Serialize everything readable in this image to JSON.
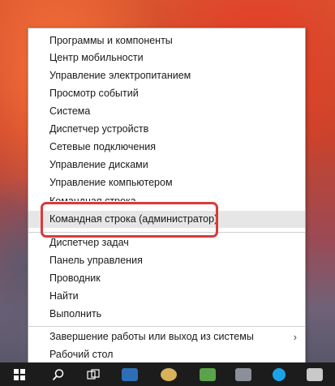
{
  "menu": {
    "items": [
      {
        "label": "Программы и компоненты"
      },
      {
        "label": "Центр мобильности"
      },
      {
        "label": "Управление электропитанием"
      },
      {
        "label": "Просмотр событий"
      },
      {
        "label": "Система"
      },
      {
        "label": "Диспетчер устройств"
      },
      {
        "label": "Сетевые подключения"
      },
      {
        "label": "Управление дисками"
      },
      {
        "label": "Управление компьютером"
      },
      {
        "label": "Командная строка"
      },
      {
        "label": "Командная строка (администратор)"
      },
      {
        "label": "Диспетчер задач"
      },
      {
        "label": "Панель управления"
      },
      {
        "label": "Проводник"
      },
      {
        "label": "Найти"
      },
      {
        "label": "Выполнить"
      },
      {
        "label": "Завершение работы или выход из системы"
      },
      {
        "label": "Рабочий стол"
      }
    ],
    "submenu_arrow": "›",
    "highlighted_item": "Командная строка (администратор)"
  },
  "annotation": {
    "color": "#d83b3b"
  },
  "taskbar": {
    "icons": [
      "start-icon",
      "search-icon",
      "task-view-icon",
      "app-icon",
      "app-icon",
      "app-icon",
      "app-icon",
      "skype-icon",
      "app-icon"
    ]
  }
}
